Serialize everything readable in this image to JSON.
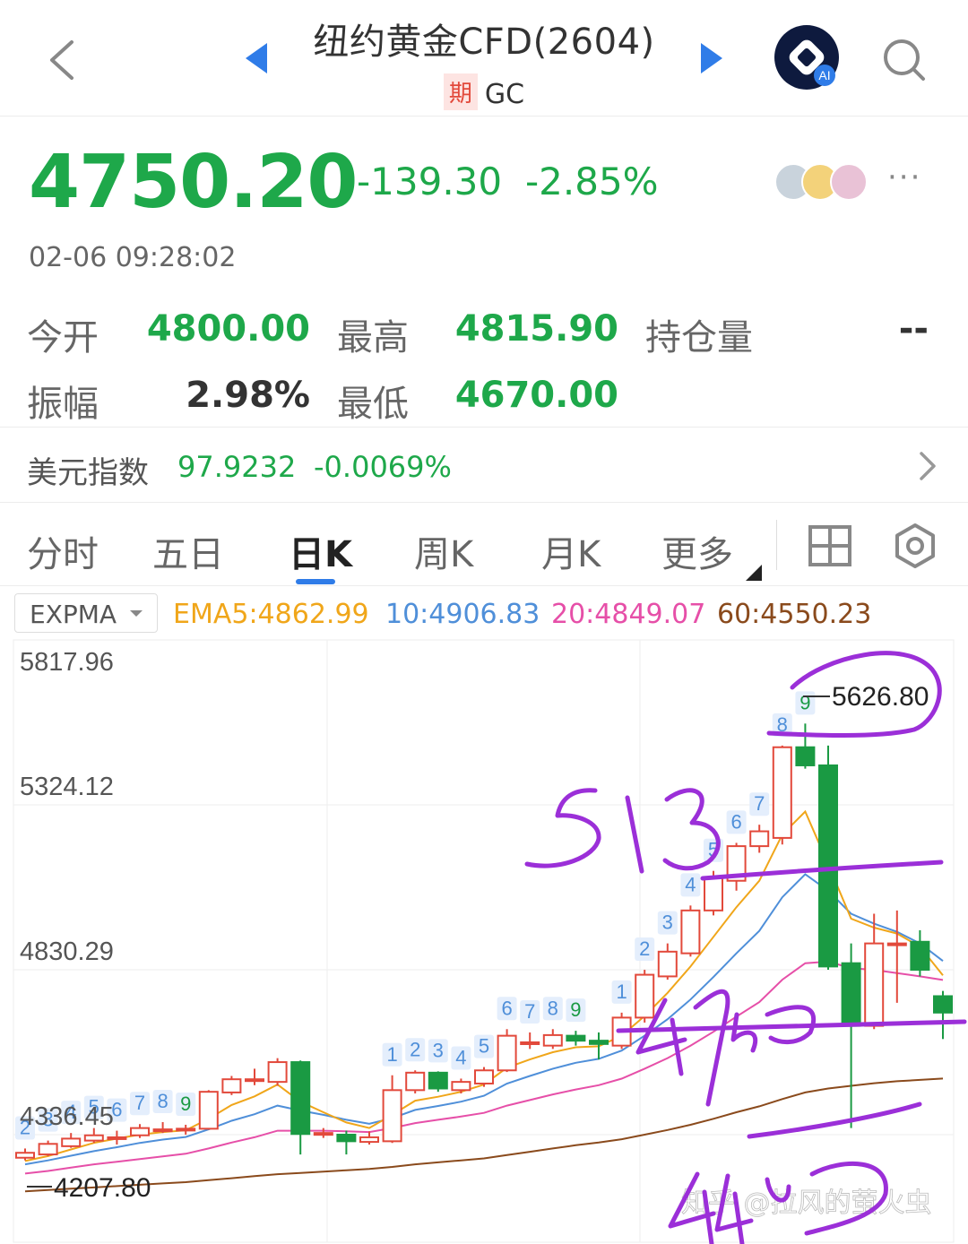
{
  "header": {
    "title": "纽约黄金CFD(2604)",
    "tag": "期",
    "code": "GC",
    "ai_badge": "AI",
    "icons": [
      "back-icon",
      "prev-icon",
      "next-icon",
      "ai-icon",
      "search-icon"
    ]
  },
  "quote": {
    "price": "4750.20",
    "change": "-139.30",
    "change_pct": "-2.85%",
    "time": "02-06 09:28:02",
    "more": "···"
  },
  "stats": {
    "open_label": "今开",
    "open_value": "4800.00",
    "high_label": "最高",
    "high_value": "4815.90",
    "oi_label": "持仓量",
    "oi_value": "--",
    "amp_label": "振幅",
    "amp_value": "2.98%",
    "low_label": "最低",
    "low_value": "4670.00"
  },
  "usd_index": {
    "label": "美元指数",
    "value": "97.9232",
    "change_pct": "-0.0069%"
  },
  "tabs": [
    {
      "label": "分时"
    },
    {
      "label": "五日"
    },
    {
      "label": "日K",
      "active": true
    },
    {
      "label": "周K"
    },
    {
      "label": "月K"
    },
    {
      "label": "更多"
    }
  ],
  "indicator": {
    "name": "EXPMA",
    "ema5": "EMA5:4862.99",
    "ema10": "10:4906.83",
    "ema20": "20:4849.07",
    "ema60": "60:4550.23"
  },
  "colors": {
    "up": "#e2493b",
    "down": "#1a9a43",
    "green_text": "#1ea84a",
    "accent": "#2f7ce8",
    "ema5": "#f0a61a",
    "ema10": "#4f8fd9",
    "ema20": "#e64fa8",
    "ema60": "#8a4a1c",
    "ink": "#9b2fd8"
  },
  "watermark": "知乎 @拉风的萤火虫",
  "chart_data": {
    "type": "candlestick",
    "y_tick_labels": [
      "5817.96",
      "5324.12",
      "4830.29",
      "4336.45"
    ],
    "ylim": [
      4200,
      5817.96
    ],
    "max_label": "5626.80",
    "min_label": "4207.80",
    "candles": [
      {
        "o": 4310,
        "c": 4325,
        "h": 4338,
        "l": 4302,
        "seq": "2"
      },
      {
        "o": 4320,
        "c": 4352,
        "h": 4362,
        "l": 4315,
        "seq": "3"
      },
      {
        "o": 4345,
        "c": 4368,
        "h": 4385,
        "l": 4340,
        "seq": "4"
      },
      {
        "o": 4362,
        "c": 4378,
        "h": 4400,
        "l": 4355,
        "seq": "5"
      },
      {
        "o": 4372,
        "c": 4372,
        "h": 4392,
        "l": 4350,
        "seq": "6"
      },
      {
        "o": 4378,
        "c": 4400,
        "h": 4412,
        "l": 4370,
        "seq": "7"
      },
      {
        "o": 4396,
        "c": 4396,
        "h": 4418,
        "l": 4385,
        "seq": "8"
      },
      {
        "o": 4394,
        "c": 4398,
        "h": 4410,
        "l": 4380,
        "seq": "9"
      },
      {
        "o": 4398,
        "c": 4510,
        "h": 4515,
        "l": 4395
      },
      {
        "o": 4508,
        "c": 4548,
        "h": 4558,
        "l": 4500
      },
      {
        "o": 4548,
        "c": 4548,
        "h": 4580,
        "l": 4530
      },
      {
        "o": 4540,
        "c": 4600,
        "h": 4612,
        "l": 4528
      },
      {
        "o": 4600,
        "c": 4382,
        "h": 4605,
        "l": 4320
      },
      {
        "o": 4380,
        "c": 4385,
        "h": 4400,
        "l": 4370
      },
      {
        "o": 4380,
        "c": 4360,
        "h": 4392,
        "l": 4320
      },
      {
        "o": 4358,
        "c": 4372,
        "h": 4390,
        "l": 4350
      },
      {
        "o": 4360,
        "c": 4515,
        "h": 4560,
        "l": 4355,
        "seq": "1"
      },
      {
        "o": 4515,
        "c": 4568,
        "h": 4575,
        "l": 4505,
        "seq": "2"
      },
      {
        "o": 4568,
        "c": 4520,
        "h": 4572,
        "l": 4510,
        "seq": "3"
      },
      {
        "o": 4515,
        "c": 4540,
        "h": 4550,
        "l": 4505,
        "seq": "4"
      },
      {
        "o": 4535,
        "c": 4575,
        "h": 4585,
        "l": 4525,
        "seq": "5"
      },
      {
        "o": 4575,
        "c": 4680,
        "h": 4700,
        "l": 4570,
        "seq": "6"
      },
      {
        "o": 4660,
        "c": 4660,
        "h": 4690,
        "l": 4640,
        "seq": "7"
      },
      {
        "o": 4650,
        "c": 4682,
        "h": 4700,
        "l": 4640,
        "seq": "8"
      },
      {
        "o": 4680,
        "c": 4665,
        "h": 4695,
        "l": 4650,
        "seq": "9"
      },
      {
        "o": 4665,
        "c": 4655,
        "h": 4690,
        "l": 4608
      },
      {
        "o": 4650,
        "c": 4735,
        "h": 4750,
        "l": 4640,
        "seq": "1"
      },
      {
        "o": 4735,
        "c": 4865,
        "h": 4880,
        "l": 4720,
        "seq": "2"
      },
      {
        "o": 4860,
        "c": 4935,
        "h": 4960,
        "l": 4850,
        "seq": "3"
      },
      {
        "o": 4930,
        "c": 5060,
        "h": 5075,
        "l": 4920,
        "seq": "4"
      },
      {
        "o": 5060,
        "c": 5160,
        "h": 5180,
        "l": 5045,
        "seq": "5"
      },
      {
        "o": 5150,
        "c": 5255,
        "h": 5265,
        "l": 5120,
        "seq": "6"
      },
      {
        "o": 5255,
        "c": 5300,
        "h": 5320,
        "l": 5235,
        "seq": "7"
      },
      {
        "o": 5280,
        "c": 5555,
        "h": 5560,
        "l": 5260,
        "seq": "8"
      },
      {
        "o": 5555,
        "c": 5500,
        "h": 5626.8,
        "l": 5490,
        "seq": "9"
      },
      {
        "o": 5500,
        "c": 4890,
        "h": 5560,
        "l": 4880
      },
      {
        "o": 4900,
        "c": 4710,
        "h": 4960,
        "l": 4400
      },
      {
        "o": 4710,
        "c": 4960,
        "h": 5050,
        "l": 4700
      },
      {
        "o": 4960,
        "c": 4960,
        "h": 5060,
        "l": 4780
      },
      {
        "o": 4965,
        "c": 4880,
        "h": 5000,
        "l": 4860
      },
      {
        "o": 4800,
        "c": 4750.2,
        "h": 4815.9,
        "l": 4670
      }
    ],
    "ema5": [
      4300,
      4315,
      4335,
      4355,
      4368,
      4380,
      4388,
      4393,
      4428,
      4470,
      4496,
      4532,
      4480,
      4448,
      4417,
      4400,
      4440,
      4483,
      4495,
      4510,
      4532,
      4583,
      4608,
      4630,
      4645,
      4648,
      4680,
      4740,
      4810,
      4890,
      4980,
      5070,
      5150,
      5290,
      5360,
      5200,
      5035,
      5008,
      4990,
      4950,
      4862.99
    ],
    "ema10": [
      4290,
      4302,
      4316,
      4330,
      4342,
      4355,
      4365,
      4373,
      4396,
      4422,
      4442,
      4468,
      4453,
      4440,
      4425,
      4413,
      4430,
      4455,
      4467,
      4480,
      4498,
      4535,
      4558,
      4580,
      4598,
      4610,
      4635,
      4680,
      4730,
      4790,
      4858,
      4930,
      4998,
      5100,
      5170,
      5120,
      5050,
      5020,
      4995,
      4960,
      4906.83
    ],
    "ema20": [
      4262,
      4270,
      4280,
      4290,
      4298,
      4306,
      4314,
      4322,
      4338,
      4356,
      4372,
      4392,
      4392,
      4392,
      4390,
      4388,
      4400,
      4415,
      4425,
      4435,
      4446,
      4468,
      4485,
      4502,
      4517,
      4530,
      4550,
      4580,
      4612,
      4650,
      4692,
      4738,
      4782,
      4850,
      4900,
      4905,
      4885,
      4880,
      4870,
      4860,
      4849.07
    ],
    "ema60": [
      4207.8,
      4212,
      4216,
      4220,
      4224,
      4228,
      4232,
      4236,
      4242,
      4248,
      4254,
      4260,
      4264,
      4268,
      4272,
      4276,
      4282,
      4290,
      4296,
      4302,
      4308,
      4318,
      4328,
      4338,
      4348,
      4356,
      4366,
      4380,
      4394,
      4410,
      4428,
      4448,
      4466,
      4488,
      4508,
      4520,
      4528,
      4536,
      4542,
      4546,
      4550.23
    ]
  }
}
